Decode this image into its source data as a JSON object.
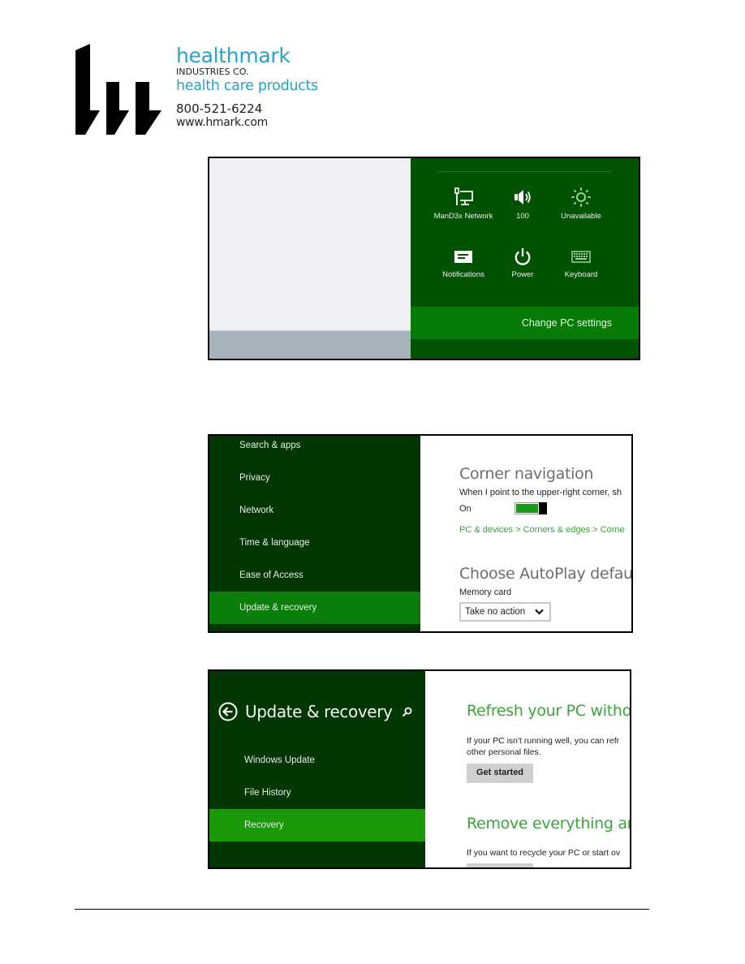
{
  "logo": {
    "brand": "healthmark",
    "subtitle": "INDUSTRIES CO.",
    "tagline": "health care products",
    "phone": "800-521-6224",
    "website": "www.hmark.com",
    "colors": {
      "brand": "#27a3c4",
      "mark": "#000000"
    }
  },
  "screenshot1": {
    "charm_tiles": [
      {
        "icon": "network-icon",
        "label": "ManD3x Network"
      },
      {
        "icon": "volume-icon",
        "label": "100"
      },
      {
        "icon": "brightness-icon",
        "label": "Unavailable"
      },
      {
        "icon": "notifications-icon",
        "label": "Notifications"
      },
      {
        "icon": "power-icon",
        "label": "Power"
      },
      {
        "icon": "keyboard-icon",
        "label": "Keyboard"
      }
    ],
    "change_pc_settings": "Change PC settings",
    "colors": {
      "charm_bg": "#005300",
      "highlight": "#077a07"
    }
  },
  "screenshot2": {
    "sidebar": {
      "items": [
        {
          "label": "Search & apps",
          "selected": false
        },
        {
          "label": "Privacy",
          "selected": false
        },
        {
          "label": "Network",
          "selected": false
        },
        {
          "label": "Time & language",
          "selected": false
        },
        {
          "label": "Ease of Access",
          "selected": false
        },
        {
          "label": "Update & recovery",
          "selected": true
        }
      ]
    },
    "main": {
      "corner_heading": "Corner navigation",
      "corner_description": "When I point to the upper-right corner, sh",
      "toggle_label": "On",
      "toggle_on": true,
      "breadcrumb": "PC & devices > Corners & edges > Corne",
      "autoplay_heading": "Choose AutoPlay defaul",
      "memory_card_label": "Memory card",
      "memory_card_value": "Take no action"
    },
    "colors": {
      "sidebar_bg": "#023602",
      "selected": "#0b7e0b",
      "toggle": "#169c16",
      "link": "#3ba33b"
    }
  },
  "screenshot3": {
    "sidebar": {
      "title": "Update & recovery",
      "items": [
        {
          "label": "Windows Update",
          "selected": false
        },
        {
          "label": "File History",
          "selected": false
        },
        {
          "label": "Recovery",
          "selected": true
        }
      ]
    },
    "main": {
      "refresh_heading": "Refresh your PC withou",
      "refresh_text_line1": "If your PC isn't running well, you can refr",
      "refresh_text_line2": "other personal files.",
      "get_started": "Get started",
      "remove_heading": "Remove everything anc",
      "remove_text": "If you want to recycle your PC or start ov"
    },
    "colors": {
      "sidebar_bg": "#023602",
      "selected": "#1a9a08",
      "heading": "#3aa63a"
    }
  }
}
